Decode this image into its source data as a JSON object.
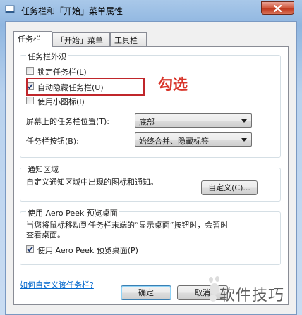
{
  "window": {
    "title": "任务栏和「开始」菜单属性"
  },
  "tabs": [
    {
      "label": "任务栏"
    },
    {
      "label": "「开始」菜单"
    },
    {
      "label": "工具栏"
    }
  ],
  "appearance": {
    "title": "任务栏外观",
    "lock_taskbar": {
      "label": "锁定任务栏(L)",
      "checked": false
    },
    "auto_hide": {
      "label": "自动隐藏任务栏(U)",
      "checked": true
    },
    "small_icons": {
      "label": "使用小图标(I)",
      "checked": false
    },
    "location_label": "屏幕上的任务栏位置(T):",
    "location_value": "底部",
    "buttons_label": "任务栏按钮(B):",
    "buttons_value": "始终合并、隐藏标签"
  },
  "notification": {
    "title": "通知区域",
    "description": "自定义通知区域中出现的图标和通知。",
    "customize_button": "自定义(C)..."
  },
  "aero_peek": {
    "title": "使用 Aero Peek 预览桌面",
    "description_line1": "当您将鼠标移动到任务栏末端的“显示桌面”按钮时，会暂时",
    "description_line2": "查看桌面。",
    "use_peek": {
      "label": "使用 Aero Peek 预览桌面(P)",
      "checked": true
    }
  },
  "help_link": "如何自定义该任务栏?",
  "footer": {
    "ok_button": "确定",
    "cancel_button": "取消"
  },
  "annotation": {
    "text": "勾选",
    "color": "#d8352a"
  },
  "watermark": {
    "text": "软件技巧"
  },
  "icons": [
    "window-icon",
    "close-icon",
    "checkmark-icon",
    "chevron-down-icon",
    "paw-icon"
  ]
}
